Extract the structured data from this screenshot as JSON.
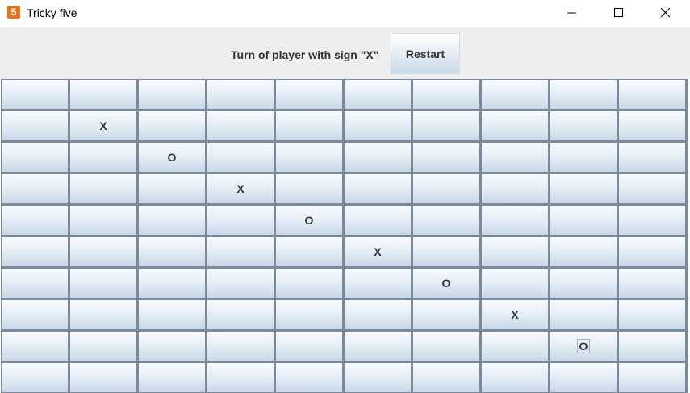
{
  "window": {
    "title": "Tricky five",
    "icon_label": "5",
    "icon_color": "#e8731a",
    "controls": [
      "minimize-icon",
      "maximize-icon",
      "close-icon"
    ]
  },
  "header": {
    "status": "Turn of player with sign \"X\"",
    "restart_label": "Restart"
  },
  "board": {
    "rows": 10,
    "cols": 10,
    "cells": [
      [
        "",
        "",
        "",
        "",
        "",
        "",
        "",
        "",
        "",
        ""
      ],
      [
        "",
        "X",
        "",
        "",
        "",
        "",
        "",
        "",
        "",
        ""
      ],
      [
        "",
        "",
        "O",
        "",
        "",
        "",
        "",
        "",
        "",
        ""
      ],
      [
        "",
        "",
        "",
        "X",
        "",
        "",
        "",
        "",
        "",
        ""
      ],
      [
        "",
        "",
        "",
        "",
        "O",
        "",
        "",
        "",
        "",
        ""
      ],
      [
        "",
        "",
        "",
        "",
        "",
        "X",
        "",
        "",
        "",
        ""
      ],
      [
        "",
        "",
        "",
        "",
        "",
        "",
        "O",
        "",
        "",
        ""
      ],
      [
        "",
        "",
        "",
        "",
        "",
        "",
        "",
        "X",
        "",
        ""
      ],
      [
        "",
        "",
        "",
        "",
        "",
        "",
        "",
        "",
        "O",
        ""
      ],
      [
        "",
        "",
        "",
        "",
        "",
        "",
        "",
        "",
        "",
        ""
      ]
    ],
    "focused_cell": [
      8,
      8
    ]
  }
}
